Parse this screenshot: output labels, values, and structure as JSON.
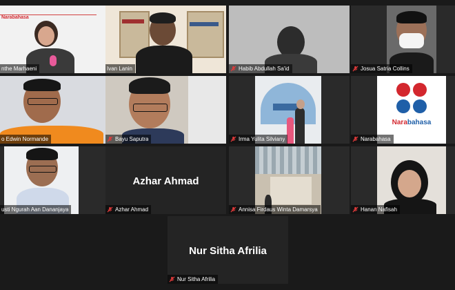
{
  "participants": [
    {
      "name": "Ruthe Marhaeni",
      "display": "nthe Marhaeni",
      "overlay_logo": "Narabahasa",
      "muted": true
    },
    {
      "name": "Ivan Lanin",
      "display": "Ivan Lanin",
      "active_speaker": true,
      "muted": false
    },
    {
      "name": "Habib Abdullah Sa'id",
      "display": "Habib Abdullah Sa'id",
      "muted": true
    },
    {
      "name": "Josua Satria Collins",
      "display": "Josua Satria Collins",
      "muted": true
    },
    {
      "name": "Edwin Normande",
      "display": "o Edwin Normande",
      "muted": true
    },
    {
      "name": "Bayu Saputra",
      "display": "Bayu Saputra",
      "muted": true
    },
    {
      "name": "Irma Yulita Silviany",
      "display": "Irma Yulita Silviany",
      "muted": true
    },
    {
      "name": "Narabahasa",
      "display": "Narabahasa",
      "logo_text": "Narabahasa",
      "muted": true
    },
    {
      "name": "Gusti Ngurah Aan Dananjaya",
      "display": "usti Ngurah Aan Dananjaya",
      "muted": true
    },
    {
      "name": "Azhar Ahmad",
      "display": "Azhar Ahmad",
      "video_off_label": "Azhar Ahmad",
      "muted": true
    },
    {
      "name": "Annisa Firdaus Winta Damarsya",
      "display": "Annisa Firdaus Winta Damarsya",
      "muted": true
    },
    {
      "name": "Hanan Nafisah",
      "display": "Hanan Nafisah",
      "muted": true
    },
    {
      "name": "Nur Sitha Afrilia",
      "display": "Nur Sitha Afrilia",
      "video_off_label": "Nur Sitha Afrilia",
      "muted": true
    }
  ],
  "colors": {
    "active_border": "#c8d84a",
    "mic_muted": "#e03a3a",
    "logo_red": "#d3272e",
    "logo_blue": "#1f5fa8"
  }
}
